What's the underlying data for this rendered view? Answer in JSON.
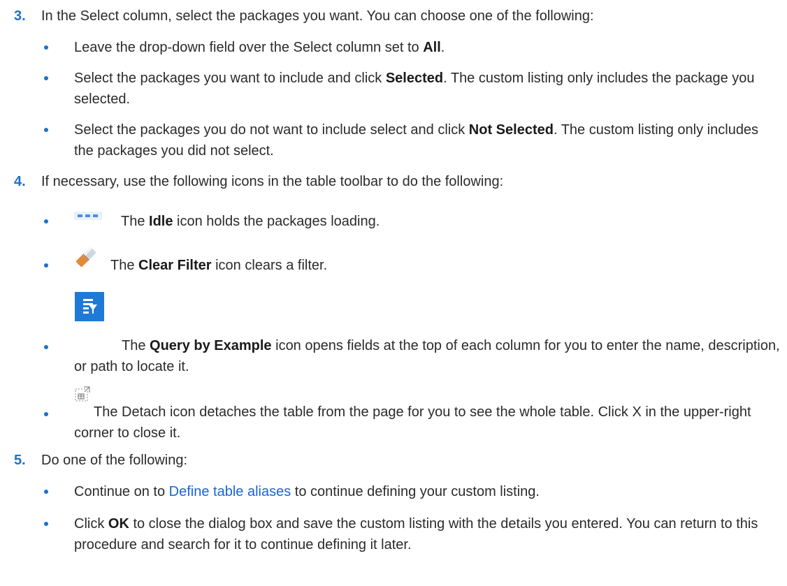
{
  "steps": [
    {
      "number": "3.",
      "text": "In the Select column, select the packages you want. You can choose one of the following:",
      "bullets": [
        {
          "pre": "Leave the drop-down field over the Select column set to ",
          "bold": "All",
          "post": "."
        },
        {
          "pre": "Select the packages you want to include and click ",
          "bold": "Selected",
          "post": ". The custom listing only includes the package you selected."
        },
        {
          "pre": "Select the packages you do not want to include select and click ",
          "bold": "Not Selected",
          "post": ". The custom listing only includes the packages you did not select."
        }
      ]
    },
    {
      "number": "4.",
      "text": "If necessary, use the following icons in the table toolbar to do the following:",
      "bullets": [
        {
          "icon": "idle-icon",
          "pre": "The ",
          "bold": "Idle",
          "post": " icon holds the packages loading."
        },
        {
          "icon": "eraser-icon",
          "pre": "The ",
          "bold": "Clear Filter",
          "post": " icon clears a filter."
        },
        {
          "icon": "query-by-example-icon",
          "pre": "The ",
          "bold": "Query by Example",
          "post": " icon opens fields at the top of each column for you to enter the name, description, or path to locate it."
        },
        {
          "icon": "detach-icon",
          "pre": "The Detach icon detaches the table from the page for you to see the whole table. Click X in the upper-right corner to close it.",
          "bold": "",
          "post": ""
        }
      ]
    },
    {
      "number": "5.",
      "text": "Do one of the following:",
      "bullets": [
        {
          "link": "Define table aliases",
          "pre": "Continue on to ",
          "post": " to continue defining your custom listing."
        },
        {
          "pre": "Click ",
          "bold": "OK",
          "post": " to close the dialog box and save the custom listing with the details you entered. You can return to this procedure and search for it to continue defining it later."
        }
      ]
    }
  ],
  "colors": {
    "accent": "#1d72c4",
    "link": "#1b64d4",
    "text": "#2b2b2b",
    "qbe_blue": "#1e7ad6"
  }
}
